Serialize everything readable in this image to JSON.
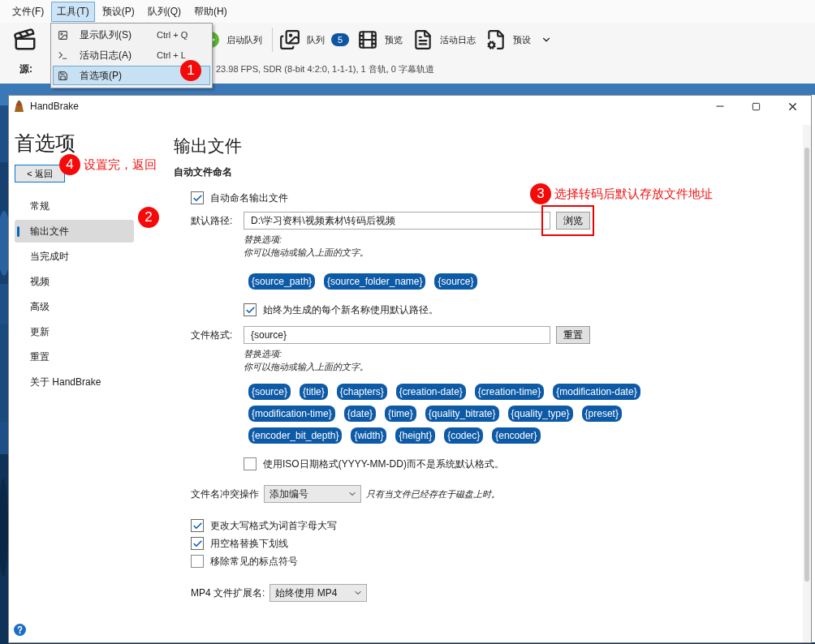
{
  "main_window": {
    "menu": [
      {
        "label": "文件(F)",
        "selected": false
      },
      {
        "label": "工具(T)",
        "selected": true
      },
      {
        "label": "预设(P)",
        "selected": false
      },
      {
        "label": "队列(Q)",
        "selected": false
      },
      {
        "label": "帮助(H)",
        "selected": false
      }
    ],
    "toolbar": [
      {
        "label": "启动队列"
      },
      {
        "label": "队列",
        "badge": "5"
      },
      {
        "label": "预览"
      },
      {
        "label": "活动日志"
      },
      {
        "label": "预设",
        "dropdown": true
      }
    ],
    "source": {
      "label": "源:",
      "info": "23.98 FPS, SDR (8-bit 4:2:0, 1-1-1), 1 音轨, 0 字幕轨道"
    }
  },
  "tools_menu": [
    {
      "label": "显示队列(S)",
      "shortcut": "Ctrl + Q",
      "selected": false
    },
    {
      "label": "活动日志(A)",
      "shortcut": "Ctrl + L",
      "selected": false
    },
    {
      "label": "首选项(P)",
      "selected": true
    }
  ],
  "preferences": {
    "window": {
      "title": "HandBrake"
    },
    "heading": "首选项",
    "back_button": "< 返回",
    "nav": [
      {
        "label": "常规",
        "selected": false
      },
      {
        "label": "输出文件",
        "selected": true
      },
      {
        "label": "当完成时",
        "selected": false
      },
      {
        "label": "视频",
        "selected": false
      },
      {
        "label": "高级",
        "selected": false
      },
      {
        "label": "更新",
        "selected": false
      },
      {
        "label": "重置",
        "selected": false
      },
      {
        "label": "关于 HandBrake",
        "selected": false
      }
    ],
    "title": "输出文件",
    "section": "自动文件命名",
    "auto_name": {
      "label": "自动命名输出文件",
      "checked": true
    },
    "default_path": {
      "label": "默认路径:",
      "value": "D:\\学习资料\\视频素材\\转码后视频",
      "button": {
        "label": "浏览",
        "highlighted": true
      }
    },
    "path_hint": [
      "替换选项:",
      "你可以拖动或输入上面的文字。"
    ],
    "path_tokens": [
      "{source_path}",
      "{source_folder_name}",
      "{source}"
    ],
    "always_default": {
      "label": "始终为生成的每个新名称使用默认路径。",
      "checked": true
    },
    "file_format": {
      "label": "文件格式:",
      "value": "{source}",
      "button": {
        "label": "重置",
        "highlighted": false
      }
    },
    "format_hint": [
      "替换选项:",
      "你可以拖动或输入上面的文字。"
    ],
    "format_tokens": [
      "{source}",
      "{title}",
      "{chapters}",
      "{creation-date}",
      "{creation-time}",
      "{modification-date}",
      "{modification-time}",
      "{date}",
      "{time}",
      "{quality_bitrate}",
      "{quality_type}",
      "{preset}",
      "{encoder_bit_depth}",
      "{width}",
      "{height}",
      "{codec}",
      "{encoder}"
    ],
    "iso_date": {
      "label": "使用ISO日期格式(YYYY-MM-DD)而不是系统默认格式。",
      "checked": false
    },
    "conflict": {
      "label": "文件名冲突操作",
      "value": "添加编号",
      "note": "只有当文件已经存在于磁盘上时。"
    },
    "options": [
      {
        "label": "更改大写格式为词首字母大写",
        "checked": true
      },
      {
        "label": "用空格替换下划线",
        "checked": true
      },
      {
        "label": "移除常见的标点符号",
        "checked": false
      }
    ],
    "mp4_ext": {
      "label": "MP4 文件扩展名:",
      "value": "始终使用 MP4"
    }
  },
  "annotations": [
    {
      "number": "1"
    },
    {
      "number": "2"
    },
    {
      "number": "3",
      "text": "选择转码后默认存放文件地址"
    },
    {
      "number": "4",
      "text": "设置完，返回"
    }
  ]
}
